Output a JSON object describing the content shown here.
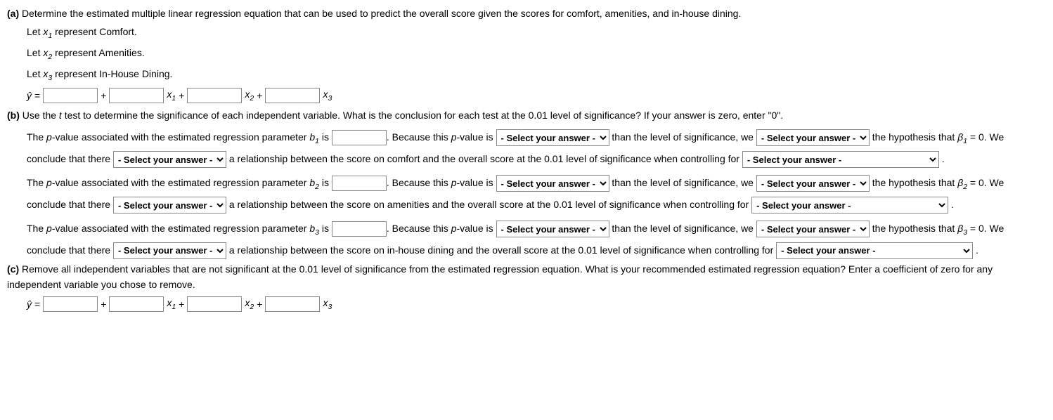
{
  "a": {
    "label": "(a)",
    "prompt": "Determine the estimated multiple linear regression equation that can be used to predict the overall score given the scores for comfort, amenities, and in-house dining.",
    "let1_pre": "Let ",
    "let1_post": " represent Comfort.",
    "let2_pre": "Let ",
    "let2_post": " represent Amenities.",
    "let3_pre": "Let ",
    "let3_post": " represent In-House Dining.",
    "eq_plus": " + ",
    "eq_equals": " = "
  },
  "b": {
    "label": "(b)",
    "prompt_pre": "Use the ",
    "prompt_post": " test to determine the significance of each independent variable. What is the conclusion for each test at the 0.01 level of significance? If your answer is zero, enter \"0\".",
    "p1_a": "The ",
    "p1_b": "-value associated with the estimated regression parameter ",
    "p1_c": " is ",
    "p1_d": ". Because this ",
    "p1_e": "-value is ",
    "p1_f": " than the level of significance, we ",
    "p1_g": " the hypothesis that ",
    "p1_h": " = 0. We conclude that there ",
    "p1_i1": " a relationship between the score on comfort and the overall score at the 0.01 level of significance when controlling for ",
    "p1_i2": " a relationship between the score on amenities and the overall score at the 0.01 level of significance when controlling for ",
    "p1_i3": " a relationship between the score on in-house dining and the overall score at the 0.01 level of significance when controlling for ",
    "p1_j": ".",
    "sel_placeholder": "- Select your answer -"
  },
  "c": {
    "label": "(c)",
    "prompt": "Remove all independent variables that are not significant at the 0.01 level of significance from the estimated regression equation. What is your recommended estimated regression equation? Enter a coefficient of zero for any independent variable you chose to remove."
  },
  "sym": {
    "yhat": "ŷ",
    "x1": "x",
    "x2": "x",
    "x3": "x",
    "b1": "b",
    "b2": "b",
    "b3": "b",
    "beta1": "β",
    "beta2": "β",
    "beta3": "β",
    "t": "t",
    "p": "p",
    "sub1": "1",
    "sub2": "2",
    "sub3": "3"
  }
}
